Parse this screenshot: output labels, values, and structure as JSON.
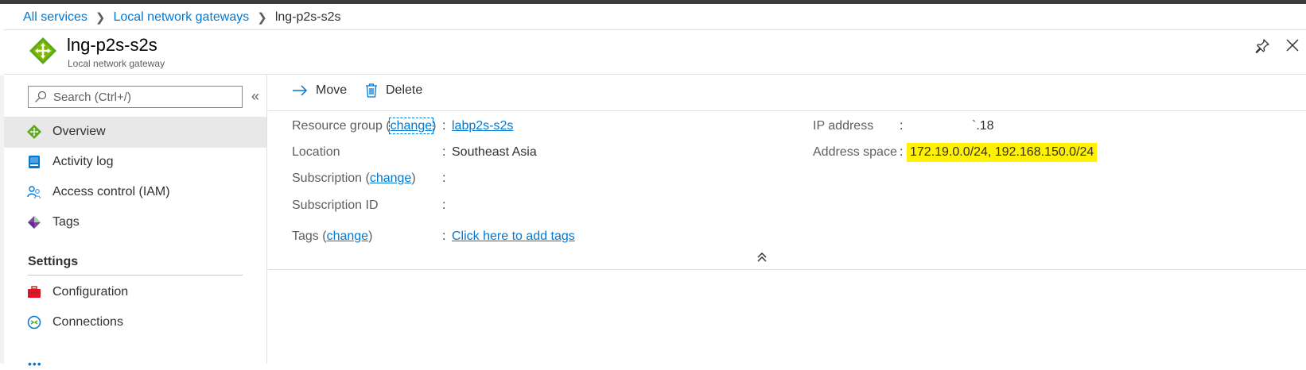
{
  "breadcrumb": {
    "items": [
      "All services",
      "Local network gateways"
    ],
    "current": "lng-p2s-s2s"
  },
  "resource": {
    "title": "lng-p2s-s2s",
    "subtitle": "Local network gateway"
  },
  "sidebar": {
    "search_placeholder": "Search (Ctrl+/)",
    "items": [
      {
        "label": "Overview",
        "icon": "overview-icon",
        "selected": true
      },
      {
        "label": "Activity log",
        "icon": "activity-log-icon"
      },
      {
        "label": "Access control (IAM)",
        "icon": "access-control-icon"
      },
      {
        "label": "Tags",
        "icon": "tag-icon"
      }
    ],
    "settings_header": "Settings",
    "settings_items": [
      {
        "label": "Configuration",
        "icon": "configuration-icon"
      },
      {
        "label": "Connections",
        "icon": "connections-icon"
      }
    ]
  },
  "toolbar": {
    "move_label": "Move",
    "delete_label": "Delete"
  },
  "essentials": {
    "resource_group": {
      "label_pre": "Resource group (",
      "change": "change",
      "label_post": ")",
      "value": "labp2s-s2s"
    },
    "location": {
      "label": "Location",
      "value": "Southeast Asia"
    },
    "subscription": {
      "label_pre": "Subscription (",
      "change": "change",
      "label_post": ")",
      "value": ""
    },
    "subscription_id": {
      "label": "Subscription ID",
      "value": ""
    },
    "tags": {
      "label_pre": "Tags (",
      "change": "change",
      "label_post": ")",
      "value": "Click here to add tags"
    },
    "ip_address": {
      "label": "IP address",
      "value": "`.18"
    },
    "address_space": {
      "label": "Address space",
      "value": "172.19.0.0/24, 192.168.150.0/24"
    }
  },
  "colors": {
    "accent": "#0078d4",
    "highlight": "#fff100",
    "selected_nav": "#e8e8e8"
  }
}
